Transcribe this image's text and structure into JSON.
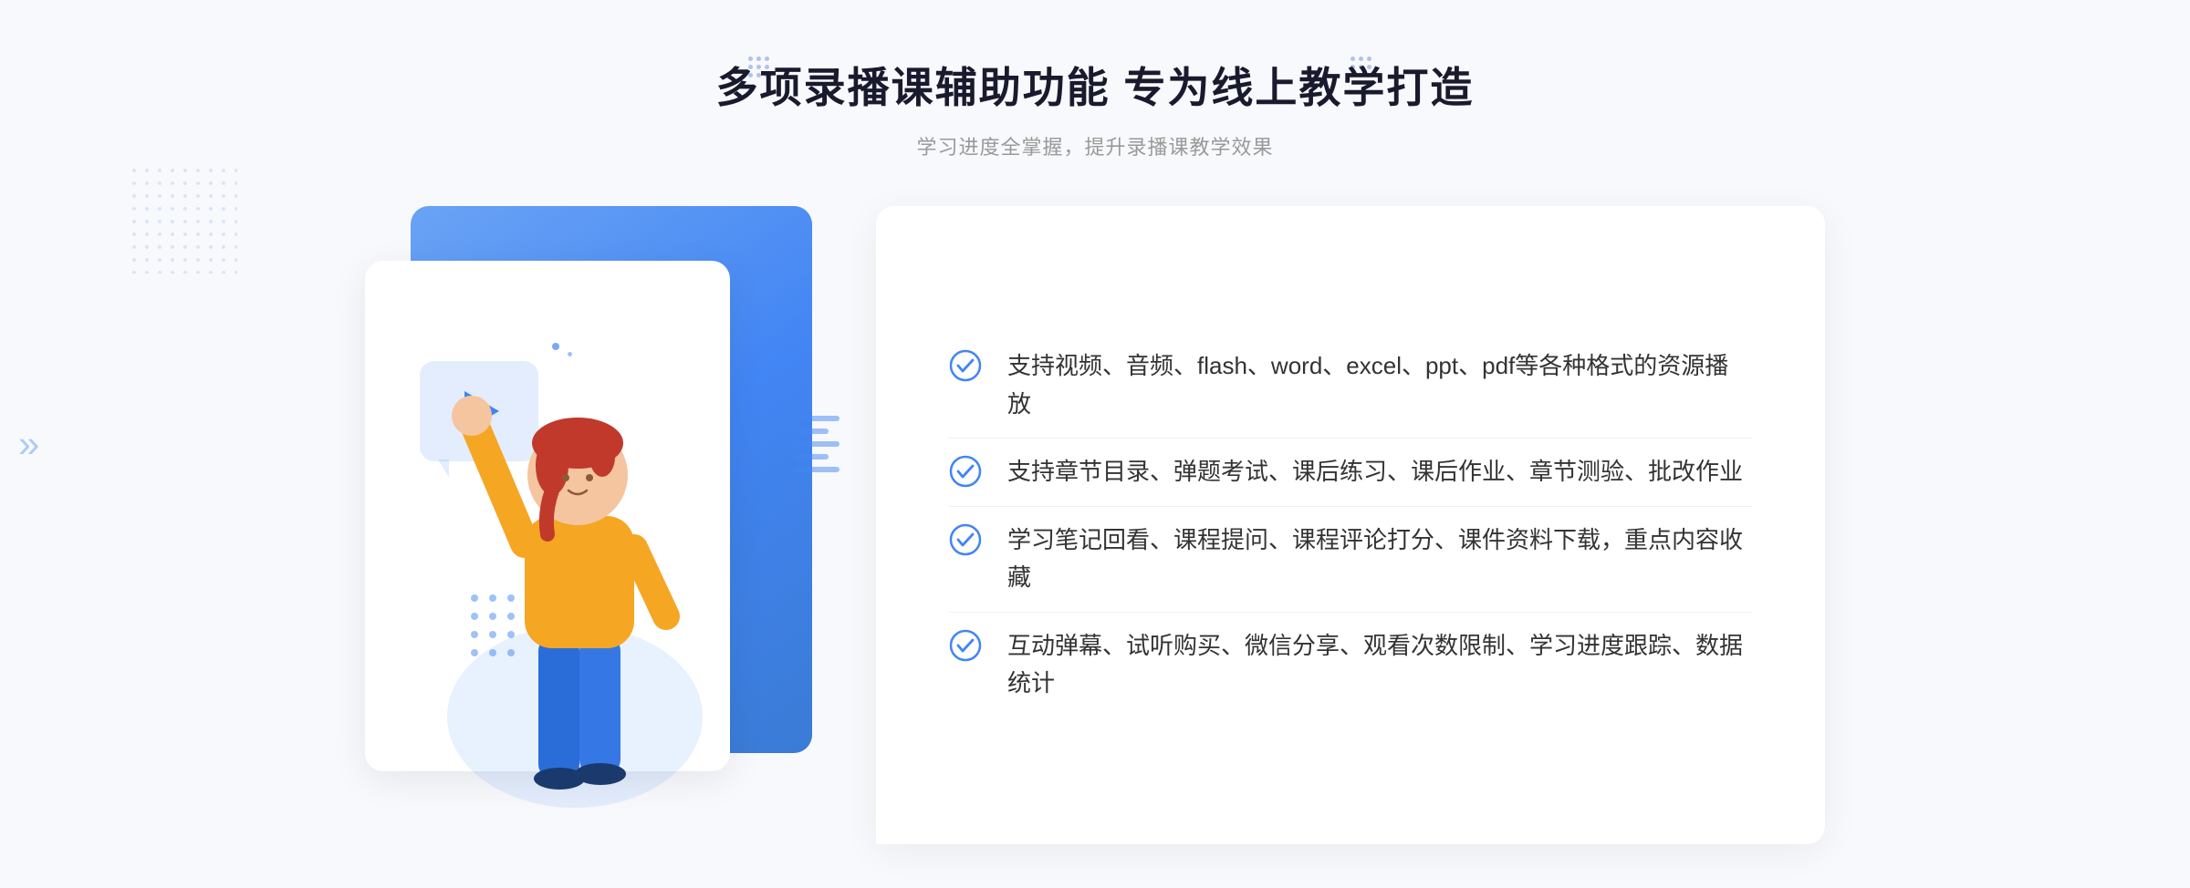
{
  "page": {
    "background_color": "#f5f7fc"
  },
  "header": {
    "main_title": "多项录播课辅助功能 专为线上教学打造",
    "sub_title": "学习进度全掌握，提升录播课教学效果"
  },
  "features": [
    {
      "id": 1,
      "text": "支持视频、音频、flash、word、excel、ppt、pdf等各种格式的资源播放"
    },
    {
      "id": 2,
      "text": "支持章节目录、弹题考试、课后练习、课后作业、章节测验、批改作业"
    },
    {
      "id": 3,
      "text": "学习笔记回看、课程提问、课程评论打分、课件资料下载，重点内容收藏"
    },
    {
      "id": 4,
      "text": "互动弹幕、试听购买、微信分享、观看次数限制、学习进度跟踪、数据统计"
    }
  ],
  "icons": {
    "check_circle": "check-circle-icon",
    "play": "play-icon",
    "left_arrow": "left-arrow-icon"
  },
  "colors": {
    "primary_blue": "#4285f4",
    "light_blue": "#6aa3f5",
    "text_dark": "#333333",
    "text_light": "#999999",
    "bg": "#f5f7fc"
  }
}
